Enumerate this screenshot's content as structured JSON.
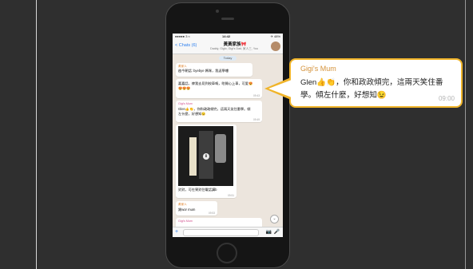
{
  "status": {
    "carrier": "●●●●● 3 ≈",
    "time": "14:42",
    "battery": "✈ 48%"
  },
  "header": {
    "back_label": "< Chats (6)",
    "group_name": "黃黃家族🎀",
    "participants": "Daddy, Giglo, Gigi's Dad, 家人三, You"
  },
  "chat": {
    "date_label": "Today",
    "messages": [
      {
        "sender": "黃家人",
        "text": "啟今朝話: byebye 媽咪，我返學嘍",
        "time": ""
      },
      {
        "sender": "",
        "text": "嘉嘉話，俾我去見到校車嘅，咁開心上車，可愛😍😍😍😍",
        "time": "09:43"
      },
      {
        "sender": "Gigi's Mum",
        "text": "Glen👍👏，你和政政傾完，這兩天笑住番學。傾左什麼，好想知😉",
        "time": "09:49"
      },
      {
        "sender": "",
        "text": "對對，可在果對住電話講b",
        "time": "09:51"
      },
      {
        "sender": "黃家人",
        "text": "謝wor mum",
        "time": "09:53"
      },
      {
        "sender": "Gigi's Mum",
        "text": "",
        "time": ""
      }
    ]
  },
  "callout": {
    "sender": "Gigi's Mum",
    "text": "Glen👍👏，你和政政傾完，這兩天笑住番學。傾左什麼，好想知😉",
    "time": "09:00"
  },
  "icons": {
    "plus": "+",
    "camera": "📷",
    "mic": "🎤",
    "play": "⬇",
    "scroll_down": "⌄"
  },
  "colors": {
    "chat_background": "#ece5dd",
    "callout_border": "#f0b429",
    "link_blue": "#2f80ed",
    "sender_orange": "#e0832b"
  }
}
